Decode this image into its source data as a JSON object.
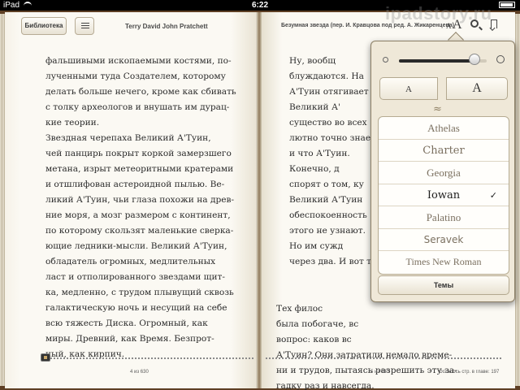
{
  "status_bar": {
    "device": "iPad",
    "time": "6:22"
  },
  "toolbar": {
    "library_label": "Библиотека",
    "toc_icon": "list-icon",
    "font_small_glyph": "A",
    "font_big_glyph": "A",
    "search_icon": "search-icon",
    "bookmark_icon": "bookmark-icon"
  },
  "left_page": {
    "header": "Terry David John Pratchett",
    "lines": [
      "фальшивыми ископаемыми костями, по-",
      "лученными туда Создателем, которому",
      "делать больше нечего, кроме как сбивать",
      "с толку археологов и внушать им дурац-",
      "кие теории.",
      "      Звездная черепаха Великий А'Туин,",
      "чей панцирь покрыт коркой замерзшего",
      "метана, изрыт метеоритными кратерами",
      "и отшлифован астероидной пылью. Ве-",
      "ликий А'Туин, чьи глаза похожи на древ-",
      "ние моря, а мозг размером с континент,",
      "по которому скользят маленькие сверка-",
      "ющие ледники-мысли. Великий А'Туин,",
      "обладатель огромных,    медлительных",
      "ласт и отполированного звездами щит-",
      "ка, медленно, с трудом плывущий сквозь",
      "галактическую ночь и несущий на себе",
      "всю тяжесть Диска. Огромный, как",
      "миры. Древний, как Время. Безпрот-",
      "ный, как кирпич."
    ],
    "footer": "4 из 630"
  },
  "right_page": {
    "header": "Безумная звезда (пер. И. Кравцова под ред. А. Жикаренцева)",
    "lines_top": [
      "      Ну, вообщ",
      "блуждаются. На",
      "А'Туин отягивает",
      "      Великий А'",
      "существо во всех",
      "лютно точно знает",
      "и что А'Туин.",
      "      Конечно, д",
      "спорят о том, ку",
      "Великий А'Туин",
      "обеспокоенность",
      "этого не узнают.",
      "      Но им сужд",
      "через два. И вот т"
    ],
    "lines_bottom": [
      "      Тех филос",
      "была побогаче, вс",
      "вопрос: каков вс",
      "А'Туин? Они затратили немало време-",
      "ни и трудов, пытаясь разрешить эту за-",
      "гадку раз и навсегда."
    ],
    "footer": "5 из 630",
    "remaining": "Осталось стр. в главе: 197"
  },
  "popover": {
    "brightness_level": 0.86,
    "size_small_label": "A",
    "size_big_label": "A",
    "flourish": "≈",
    "fonts": [
      {
        "name": "Athelas",
        "selected": false
      },
      {
        "name": "Charter",
        "selected": false
      },
      {
        "name": "Georgia",
        "selected": false
      },
      {
        "name": "Iowan",
        "selected": true
      },
      {
        "name": "Palatino",
        "selected": false
      },
      {
        "name": "Seravek",
        "selected": false
      },
      {
        "name": "Times New Roman",
        "selected": false
      }
    ],
    "check_glyph": "✓",
    "themes_label": "Темы"
  },
  "watermark": "ipadstory.ru",
  "colors": {
    "page": "#fbf9f3",
    "wood": "#6b4a2e",
    "popover": "#efe8d8"
  }
}
